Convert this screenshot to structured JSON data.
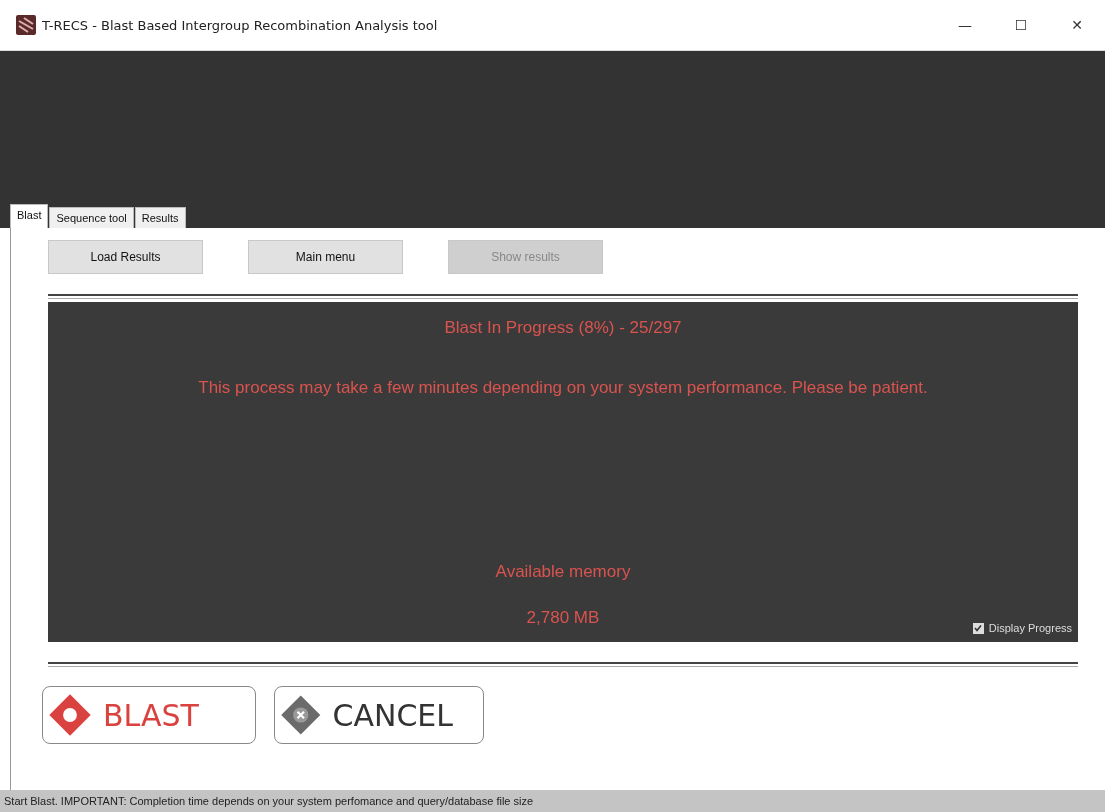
{
  "window": {
    "title": "T-RECS - Blast Based Intergroup Recombination Analysis tool",
    "controls": [
      "—",
      "☐",
      "✕"
    ]
  },
  "tabs": [
    {
      "label": "Blast",
      "selected": true
    },
    {
      "label": "Sequence tool",
      "selected": false
    },
    {
      "label": "Results",
      "selected": false
    }
  ],
  "toolbar": [
    {
      "label": "Load Results",
      "disabled": false
    },
    {
      "label": "Main menu",
      "disabled": false
    },
    {
      "label": "Show results",
      "disabled": true
    }
  ],
  "progress_panel": {
    "title": "Blast In Progress (8%) - 25/297",
    "message": "This process may take a few minutes depending on your system performance. Please be patient.",
    "memory_label": "Available memory",
    "memory_value": "2,780 MB",
    "display_progress": {
      "label": "Display Progress",
      "checked": true
    }
  },
  "actions": [
    {
      "label": "BLAST",
      "kind": "blast"
    },
    {
      "label": "CANCEL",
      "kind": "cancel"
    }
  ],
  "status_bar": "Start Blast. IMPORTANT: Completion time depends on your system perfomance and query/database file size"
}
